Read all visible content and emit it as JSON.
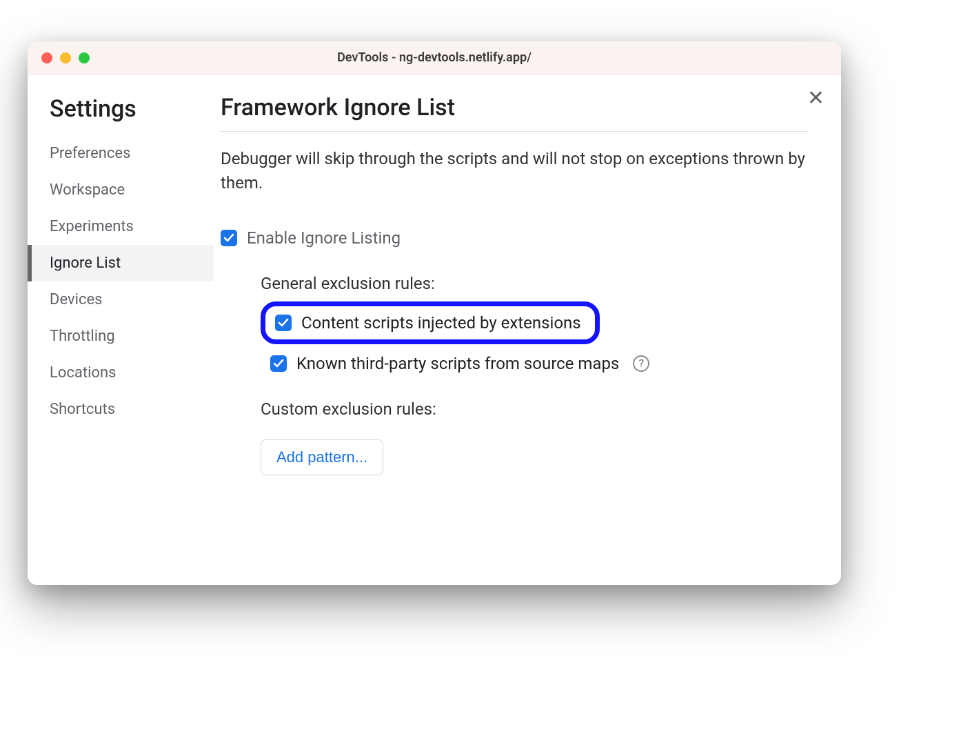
{
  "window": {
    "title": "DevTools - ng-devtools.netlify.app/"
  },
  "sidebar": {
    "heading": "Settings",
    "items": [
      {
        "label": "Preferences",
        "active": false
      },
      {
        "label": "Workspace",
        "active": false
      },
      {
        "label": "Experiments",
        "active": false
      },
      {
        "label": "Ignore List",
        "active": true
      },
      {
        "label": "Devices",
        "active": false
      },
      {
        "label": "Throttling",
        "active": false
      },
      {
        "label": "Locations",
        "active": false
      },
      {
        "label": "Shortcuts",
        "active": false
      }
    ]
  },
  "main": {
    "title": "Framework Ignore List",
    "description": "Debugger will skip through the scripts and will not stop on exceptions thrown by them.",
    "enable": {
      "label": "Enable Ignore Listing",
      "checked": true
    },
    "general_rules_heading": "General exclusion rules:",
    "rules": {
      "content_scripts": {
        "label": "Content scripts injected by extensions",
        "checked": true
      },
      "third_party": {
        "label": "Known third-party scripts from source maps",
        "checked": true
      }
    },
    "custom_rules_heading": "Custom exclusion rules:",
    "add_pattern_button": "Add pattern..."
  }
}
